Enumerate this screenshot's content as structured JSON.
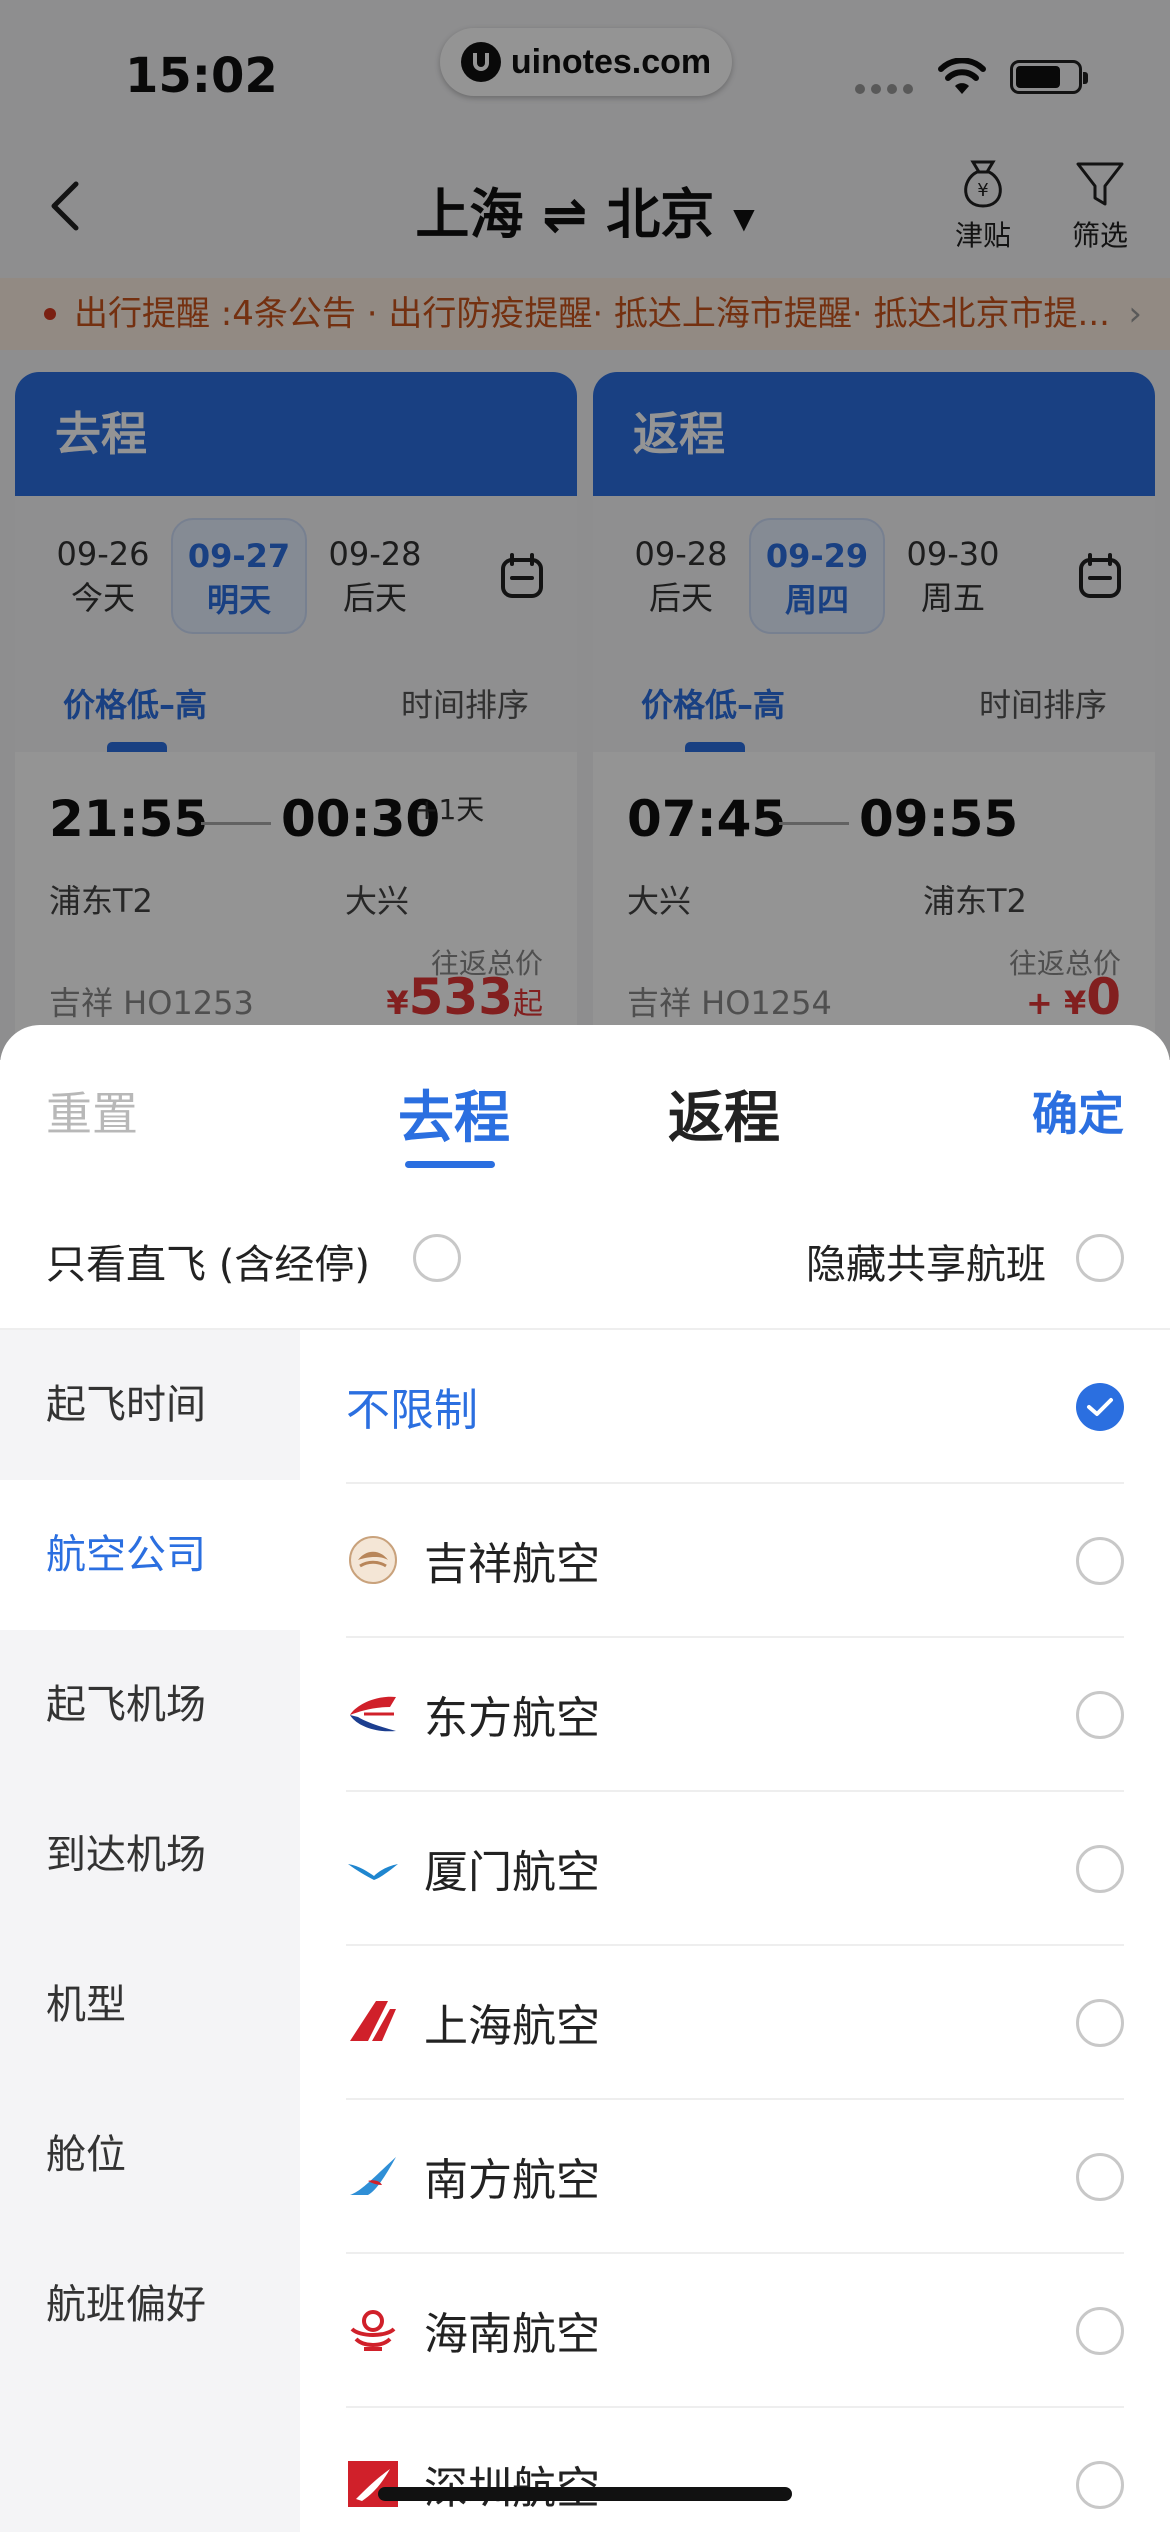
{
  "status_bar": {
    "time": "15:02",
    "watermark": "uinotes.com"
  },
  "nav": {
    "title_from": "上海",
    "title_sep": "⇌",
    "title_to": "北京",
    "subsidy_label": "津贴",
    "filter_label": "筛选"
  },
  "notice": {
    "text": "出行提醒 :4条公告 · 出行防疫提醒· 抵达上海市提醒· 抵达北京市提..."
  },
  "outbound": {
    "header": "去程",
    "dates": [
      {
        "date": "09-26",
        "label": "今天"
      },
      {
        "date": "09-27",
        "label": "明天"
      },
      {
        "date": "09-28",
        "label": "后天"
      }
    ],
    "sort_price": "价格低–高",
    "sort_time": "时间排序",
    "flight": {
      "dep_time": "21:55",
      "arr_time": "00:30",
      "plus_day": "+1天",
      "dep_airport": "浦东T2",
      "arr_airport": "大兴",
      "total_label": "往返总价",
      "code": "吉祥 HO1253",
      "currency": "¥",
      "price": "533",
      "price_suffix": "起"
    }
  },
  "return": {
    "header": "返程",
    "dates": [
      {
        "date": "09-28",
        "label": "后天"
      },
      {
        "date": "09-29",
        "label": "周四"
      },
      {
        "date": "09-30",
        "label": "周五"
      }
    ],
    "sort_price": "价格低–高",
    "sort_time": "时间排序",
    "flight": {
      "dep_time": "07:45",
      "arr_time": "09:55",
      "dep_airport": "大兴",
      "arr_airport": "浦东T2",
      "total_label": "往返总价",
      "code": "吉祥 HO1254",
      "price_prefix": "+ ¥",
      "price": "0"
    }
  },
  "sheet": {
    "reset": "重置",
    "tab_outbound": "去程",
    "tab_return": "返程",
    "confirm": "确定",
    "direct_only": "只看直飞 (含经停)",
    "hide_shared": "隐藏共享航班",
    "categories": [
      "起飞时间",
      "航空公司",
      "起飞机场",
      "到达机场",
      "机型",
      "舱位",
      "航班偏好"
    ],
    "active_category": "航空公司",
    "unlimited": "不限制",
    "airlines": [
      {
        "name": "吉祥航空",
        "icon": "juneyao-logo"
      },
      {
        "name": "东方航空",
        "icon": "china-eastern-logo"
      },
      {
        "name": "厦门航空",
        "icon": "xiamen-air-logo"
      },
      {
        "name": "上海航空",
        "icon": "shanghai-air-logo"
      },
      {
        "name": "南方航空",
        "icon": "china-southern-logo"
      },
      {
        "name": "海南航空",
        "icon": "hainan-air-logo"
      },
      {
        "name": "深圳航空",
        "icon": "shenzhen-air-logo"
      }
    ]
  },
  "colors": {
    "accent": "#2b6fe0",
    "price_red": "#e03636",
    "notice_orange": "#c8541c"
  }
}
